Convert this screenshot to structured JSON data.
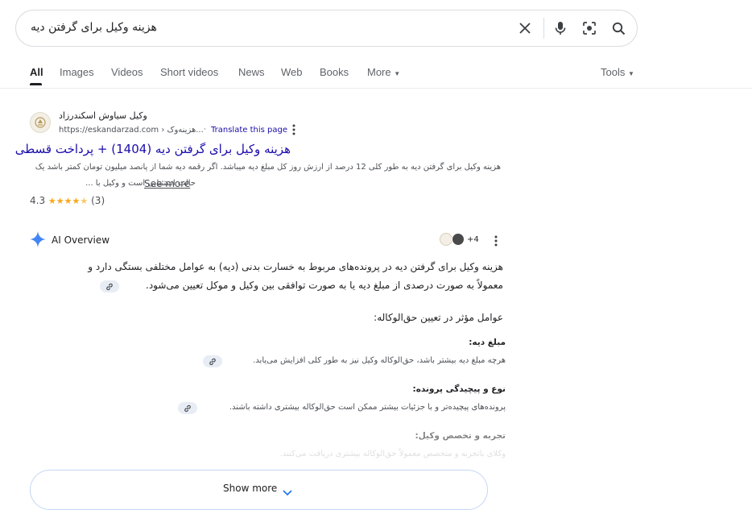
{
  "search": {
    "query": "هزینه وکیل برای گرفتن دیه"
  },
  "tabs": [
    {
      "label": "All"
    },
    {
      "label": "Images"
    },
    {
      "label": "Videos"
    },
    {
      "label": "Short videos"
    },
    {
      "label": "News"
    },
    {
      "label": "Web"
    },
    {
      "label": "Books"
    },
    {
      "label": "More"
    }
  ],
  "tools_label": "Tools",
  "result": {
    "site_name": "وکیل سیاوش اسکندرزاد",
    "url": "https://eskandarzad.com › هزینه‌وک...",
    "translate": "Translate this page",
    "title": "هزینه وکیل برای گرفتن دیه (1404) + پرداخت قسطی",
    "snippet_line1": "هزینه وکیل برای گرفتن دیه به طور کلی 12 درصد از ارزش روز کل مبلغ دیه میباشد. اگر رقمه دیه شما از پانصد میلیون تومان کمتر باشد یک",
    "snippet_line2": "حالت استثنایی است و وکیل با ...",
    "see_more": "See more",
    "rating": "4.3",
    "reviews": "(3)"
  },
  "ai_overview": {
    "label": "AI Overview",
    "sources_more": "+4",
    "intro_line1": "هزینه وکیل برای گرفتن دیه در پرونده‌های مربوط به خسارت بدنی (دیه) به عوامل مختلفی بستگی دارد و",
    "intro_line2": "معمولاً به صورت درصدی از مبلغ دیه یا به صورت توافقی بین وکیل و موکل تعیین می‌شود.",
    "factors_heading": "عوامل مؤثر در تعیین حق‌الوکاله:",
    "item1_title": "مبلغ دیه:",
    "item1_text": "هرچه مبلغ دیه بیشتر باشد، حق‌الوکاله وکیل نیز به طور کلی افزایش می‌یابد.",
    "item2_title": "نوع و پیچیدگی پرونده:",
    "item2_text": "پرونده‌های پیچیده‌تر و با جزئیات بیشتر ممکن است حق‌الوکاله بیشتری داشته باشند.",
    "item3_title": "تجربه و تخصص وکیل:",
    "item3_text": "وکلای باتجربه و متخصص معمولاً حق‌الوکاله بیشتری دریافت می‌کنند.",
    "show_more": "Show more"
  },
  "colors": {
    "link": "#1a0dab",
    "star": "#f8a81a",
    "ai_blue": "#4285f4"
  }
}
